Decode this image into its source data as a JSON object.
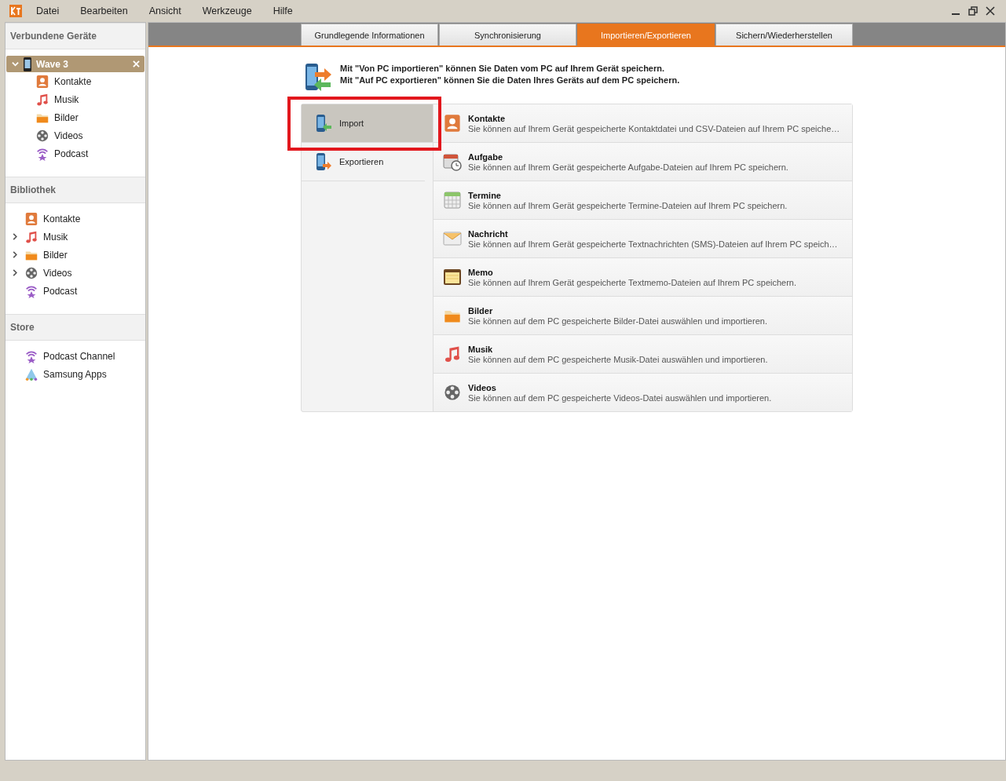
{
  "menu": [
    "Datei",
    "Bearbeiten",
    "Ansicht",
    "Werkzeuge",
    "Hilfe"
  ],
  "sidebar": {
    "devices": {
      "title": "Verbundene Geräte",
      "device": {
        "name": "Wave 3",
        "expanded": true,
        "selected": true,
        "children": [
          {
            "label": "Kontakte",
            "kind": "contacts"
          },
          {
            "label": "Musik",
            "kind": "music"
          },
          {
            "label": "Bilder",
            "kind": "pictures"
          },
          {
            "label": "Videos",
            "kind": "videos"
          },
          {
            "label": "Podcast",
            "kind": "podcast"
          }
        ]
      }
    },
    "library": {
      "title": "Bibliothek",
      "items": [
        {
          "label": "Kontakte",
          "kind": "contacts",
          "expandable": false
        },
        {
          "label": "Musik",
          "kind": "music",
          "expandable": true
        },
        {
          "label": "Bilder",
          "kind": "pictures",
          "expandable": true
        },
        {
          "label": "Videos",
          "kind": "videos",
          "expandable": true
        },
        {
          "label": "Podcast",
          "kind": "podcast",
          "expandable": false
        }
      ]
    },
    "store": {
      "title": "Store",
      "items": [
        {
          "label": "Podcast Channel",
          "kind": "podcast"
        },
        {
          "label": "Samsung Apps",
          "kind": "apps"
        }
      ]
    }
  },
  "tabs": [
    {
      "label": "Grundlegende Informationen",
      "selected": false
    },
    {
      "label": "Synchronisierung",
      "selected": false
    },
    {
      "label": "Importieren/Exportieren",
      "selected": true
    },
    {
      "label": "Sichern/Wiederherstellen",
      "selected": false
    }
  ],
  "intro": [
    "Mit \"Von PC importieren\" können Sie Daten vom PC auf Ihrem Gerät speichern.",
    "Mit \"Auf PC exportieren\" können Sie die Daten Ihres Geräts auf dem PC speichern."
  ],
  "modes": [
    {
      "label": "Import",
      "kind": "import",
      "selected": true,
      "highlighted": true
    },
    {
      "label": "Exportieren",
      "kind": "export",
      "selected": false,
      "highlighted": false
    }
  ],
  "categories": [
    {
      "title": "Kontakte",
      "kind": "contacts",
      "description": "Sie können auf Ihrem Gerät gespeicherte Kontaktdatei und CSV-Dateien auf Ihrem PC speiche…"
    },
    {
      "title": "Aufgabe",
      "kind": "task",
      "description": "Sie können auf Ihrem Gerät gespeicherte Aufgabe-Dateien auf Ihrem PC speichern."
    },
    {
      "title": "Termine",
      "kind": "calendar",
      "description": "Sie können auf Ihrem Gerät gespeicherte Termine-Dateien auf Ihrem PC speichern."
    },
    {
      "title": "Nachricht",
      "kind": "message",
      "description": "Sie können auf Ihrem Gerät gespeicherte Textnachrichten (SMS)-Dateien auf Ihrem PC speich…"
    },
    {
      "title": "Memo",
      "kind": "memo",
      "description": "Sie können auf Ihrem Gerät gespeicherte Textmemo-Dateien auf Ihrem PC speichern."
    },
    {
      "title": "Bilder",
      "kind": "pictures",
      "description": "Sie können auf dem PC gespeicherte Bilder-Datei auswählen und importieren."
    },
    {
      "title": "Musik",
      "kind": "music",
      "description": "Sie können auf dem PC gespeicherte Musik-Datei auswählen und importieren."
    },
    {
      "title": "Videos",
      "kind": "videos",
      "description": "Sie können auf dem PC gespeicherte Videos-Datei auswählen und importieren."
    }
  ]
}
